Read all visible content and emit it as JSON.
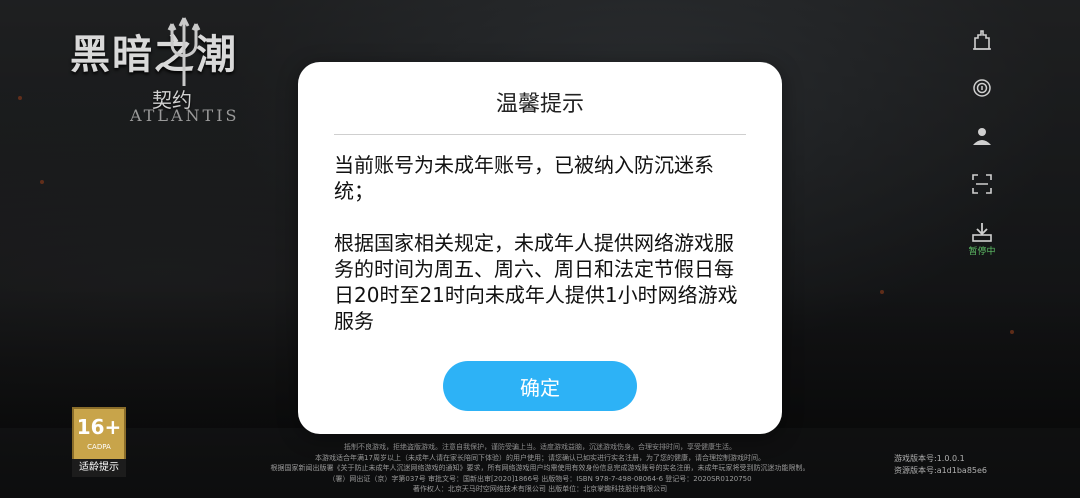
{
  "logo": {
    "title": "黑暗之潮",
    "subtitle": "契约",
    "english": "ATLANTIS"
  },
  "toolbar": {
    "icons": [
      "castle-icon",
      "fingerprint-icon",
      "user-gear-icon",
      "scan-icon",
      "download-icon"
    ],
    "status_label": "暂停中",
    "status_color": "#5fbf67"
  },
  "dialog": {
    "title": "温馨提示",
    "paragraph1": "当前账号为未成年账号，已被纳入防沉迷系统；",
    "paragraph2": "根据国家相关规定，未成年人提供网络游戏服务的时间为周五、周六、周日和法定节假日每日20时至21时向未成年人提供1小时网络游戏服务",
    "confirm_label": "确定",
    "accent_color": "#2db2f6"
  },
  "age_rating": {
    "age": "16+",
    "org": "CADPA",
    "tip": "适龄提示"
  },
  "legal": {
    "lines": [
      "抵制不良游戏，拒绝盗版游戏。注意自我保护，谨防受骗上当。适度游戏益脑，沉迷游戏伤身。合理安排时间，享受健康生活。",
      "本游戏适合年满17周岁以上（未成年人请在家长陪同下体验）的用户使用；请您确认已如实进行实名注册，为了您的健康，请合理控制游戏时间。",
      "根据国家新闻出版署《关于防止未成年人沉迷网络游戏的通知》要求，所有网络游戏用户均需使用有效身份信息完成游戏账号的实名注册，未成年玩家将受到防沉迷功能限制。",
      "（署）网出证（京）字第037号 审批文号：国新出审[2020]1866号 出版物号：ISBN 978-7-498-08064-6 登记号：2020SR0120750",
      "著作权人：北京天马时空网络技术有限公司 出版单位：北京掌趣科技股份有限公司"
    ]
  },
  "version": {
    "game": "游戏版本号:1.0.0.1",
    "resource": "资源版本号:a1d1ba85e6"
  }
}
